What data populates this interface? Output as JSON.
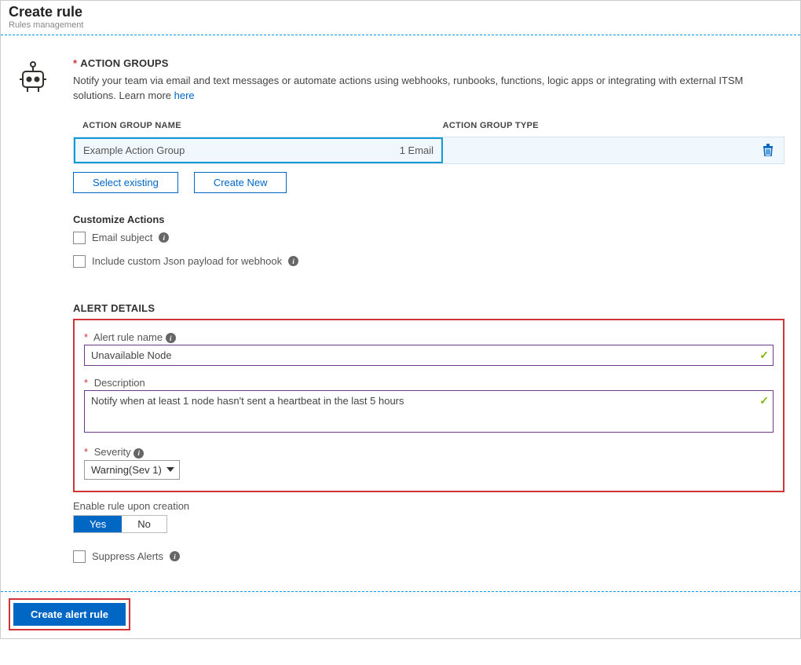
{
  "header": {
    "title": "Create rule",
    "subtitle": "Rules management"
  },
  "actionGroups": {
    "heading": "ACTION GROUPS",
    "description": "Notify your team via email and text messages or automate actions using webhooks, runbooks, functions, logic apps or integrating with external ITSM solutions. Learn more ",
    "learnMoreText": "here",
    "columns": {
      "name": "ACTION GROUP NAME",
      "type": "ACTION GROUP TYPE"
    },
    "row": {
      "name": "Example Action Group",
      "count": "1 Email"
    },
    "selectExisting": "Select existing",
    "createNew": "Create New"
  },
  "customize": {
    "heading": "Customize Actions",
    "emailSubject": "Email subject",
    "jsonPayload": "Include custom Json payload for webhook"
  },
  "alertDetails": {
    "heading": "ALERT DETAILS",
    "nameLabel": "Alert rule name",
    "nameValue": "Unavailable Node",
    "descLabel": "Description",
    "descValue": "Notify when at least 1 node hasn't sent a heartbeat in the last 5 hours",
    "severityLabel": "Severity",
    "severityValue": "Warning(Sev 1)"
  },
  "enableRule": {
    "label": "Enable rule upon creation",
    "yes": "Yes",
    "no": "No"
  },
  "suppress": {
    "label": "Suppress Alerts"
  },
  "footer": {
    "createButton": "Create alert rule"
  }
}
